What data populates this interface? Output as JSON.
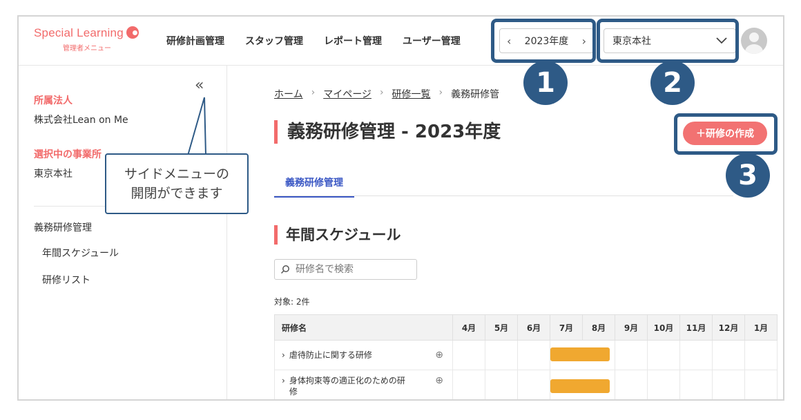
{
  "logo": {
    "name": "Special Learning",
    "subtitle": "管理者メニュー"
  },
  "nav": [
    "研修計画管理",
    "スタッフ管理",
    "レポート管理",
    "ユーザー管理"
  ],
  "year_selector": {
    "prev": "‹",
    "value": "2023年度",
    "next": "›"
  },
  "office_select": {
    "value": "東京本社"
  },
  "sidebar": {
    "collapse": "«",
    "affiliation_label": "所属法人",
    "affiliation_value": "株式会社Lean on Me",
    "office_label": "選択中の事業所",
    "office_value": "東京本社",
    "menu_title": "義務研修管理",
    "menu_items": [
      "年間スケジュール",
      "研修リスト"
    ]
  },
  "breadcrumb": [
    "ホーム",
    "マイページ",
    "研修一覧",
    "義務研修管"
  ],
  "page_title": "義務研修管理 - 2023年度",
  "add_button": "＋研修の作成",
  "tab": "義務研修管理",
  "section_title": "年間スケジュール",
  "search": {
    "placeholder": "研修名で検索"
  },
  "count": "対象: 2件",
  "table": {
    "name_header": "研修名",
    "months": [
      "4月",
      "5月",
      "6月",
      "7月",
      "8月",
      "9月",
      "10月",
      "11月",
      "12月",
      "1月"
    ],
    "rows": [
      {
        "name": "虐待防止に関する研修",
        "start_month": "7月",
        "end_month": "8月"
      },
      {
        "name_line1": "身体拘束等の適正化のための研",
        "name_line2": "修",
        "start_month": "7月",
        "end_month": "8月"
      }
    ]
  },
  "annotations": {
    "tooltip_line1": "サイドメニューの",
    "tooltip_line2": "開閉ができます",
    "badges": [
      "1",
      "2",
      "3"
    ]
  },
  "colors": {
    "brand": "#f26b6b",
    "accent": "#3a57c4",
    "annotation": "#2e5a86",
    "bar": "#f0a830"
  }
}
